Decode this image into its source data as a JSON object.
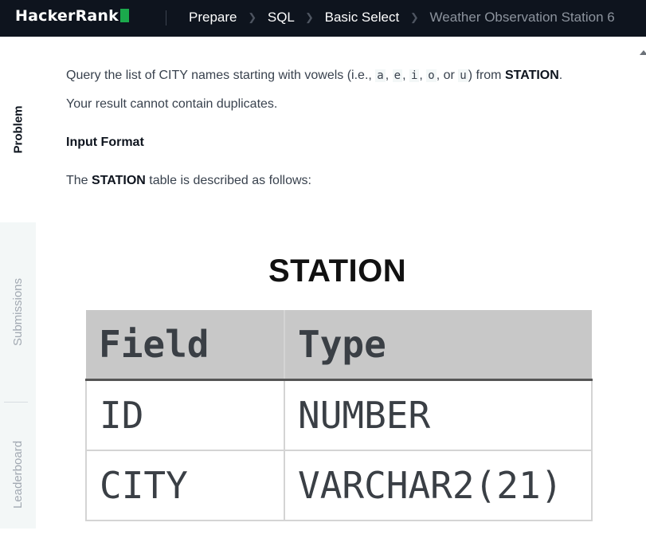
{
  "header": {
    "logo": "HackerRank",
    "breadcrumbs": [
      {
        "label": "Prepare"
      },
      {
        "label": "SQL"
      },
      {
        "label": "Basic Select"
      },
      {
        "label": "Weather Observation Station 6"
      }
    ]
  },
  "sidebar": {
    "tabs": [
      {
        "label": "Problem"
      },
      {
        "label": "Submissions"
      },
      {
        "label": "Leaderboard"
      }
    ]
  },
  "problem": {
    "p1_before": "Query the list of CITY names starting with vowels (i.e., ",
    "vowels": [
      "a",
      "e",
      "i",
      "o",
      "u"
    ],
    "sep_comma": ", ",
    "sep_or": ", or ",
    "p1_from": ") from ",
    "p1_table": "STATION",
    "p1_end": ".",
    "p2": "Your result cannot contain duplicates.",
    "input_format_heading": "Input Format",
    "p3_before": "The ",
    "p3_table": "STATION",
    "p3_after": " table is described as follows:"
  },
  "station_figure": {
    "title": "STATION",
    "headers": [
      "Field",
      "Type"
    ],
    "rows": [
      [
        "ID",
        "NUMBER"
      ],
      [
        "CITY",
        "VARCHAR2(21)"
      ]
    ]
  }
}
